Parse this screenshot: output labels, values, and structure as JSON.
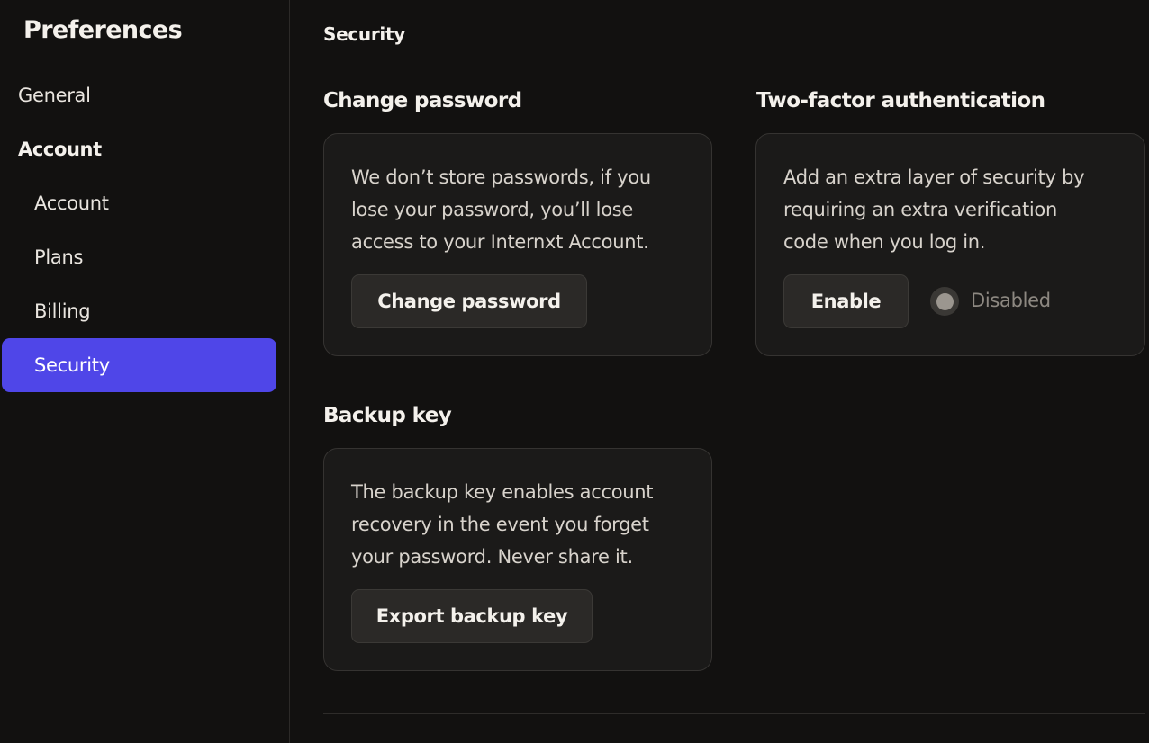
{
  "sidebar": {
    "title": "Preferences",
    "general": "General",
    "group_label": "Account",
    "items": [
      {
        "label": "Account"
      },
      {
        "label": "Plans"
      },
      {
        "label": "Billing"
      },
      {
        "label": "Security"
      }
    ],
    "active_item": "Security"
  },
  "main": {
    "page_title": "Security",
    "change_password": {
      "title": "Change password",
      "lines": [
        "We don’t store passwords, if you",
        "lose your password, you’ll lose",
        "access to your Internxt Account."
      ],
      "button_label": "Change password"
    },
    "two_factor": {
      "title": "Two-factor authentication",
      "lines": [
        "Add an extra layer of security by",
        "requiring an extra verification",
        "code when you log in."
      ],
      "button_label": "Enable",
      "status_label": "Disabled"
    },
    "backup_key": {
      "title": "Backup key",
      "lines": [
        "The backup key enables account",
        "recovery in the event you forget",
        "your password. Never share it."
      ],
      "button_label": "Export backup key"
    }
  },
  "colors": {
    "background": "#121110",
    "card": "#1b1a19",
    "accent": "#4f46e8",
    "button": "#2b2927"
  }
}
